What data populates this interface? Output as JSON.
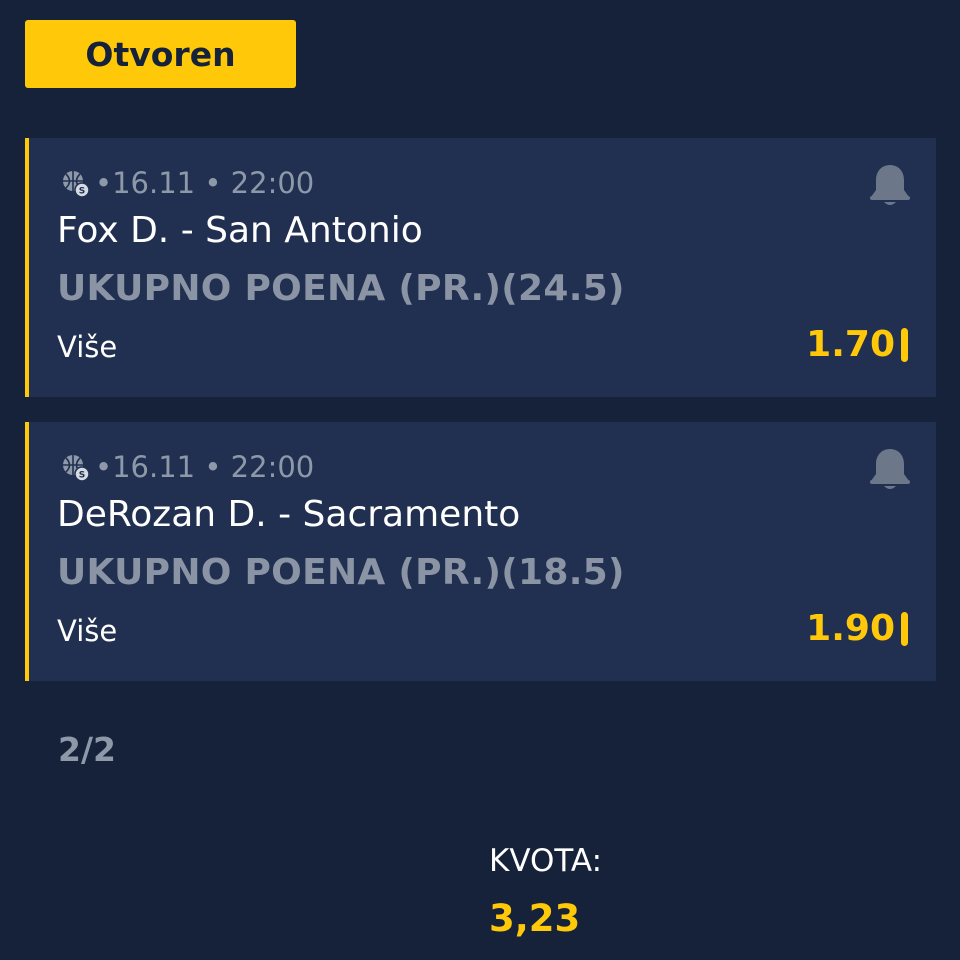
{
  "status": {
    "label": "Otvoren"
  },
  "icons": {
    "sport": "basketball-icon",
    "notify": "bell-icon"
  },
  "colors": {
    "background": "#15223a",
    "card": "#213050",
    "accent": "#ffc90a",
    "muted": "#8d98a9"
  },
  "tickets": [
    {
      "meta": "•16.11 • 22:00",
      "match": "Fox D. - San Antonio",
      "market": "UKUPNO POENA (PR.)(24.5)",
      "pick": "Više",
      "odd": "1.70"
    },
    {
      "meta": "•16.11 • 22:00",
      "match": "DeRozan D. - Sacramento",
      "market": "UKUPNO POENA (PR.)(18.5)",
      "pick": "Više",
      "odd": "1.90"
    }
  ],
  "pager": "2/2",
  "total": {
    "label": "KVOTA:",
    "value": "3,23"
  }
}
